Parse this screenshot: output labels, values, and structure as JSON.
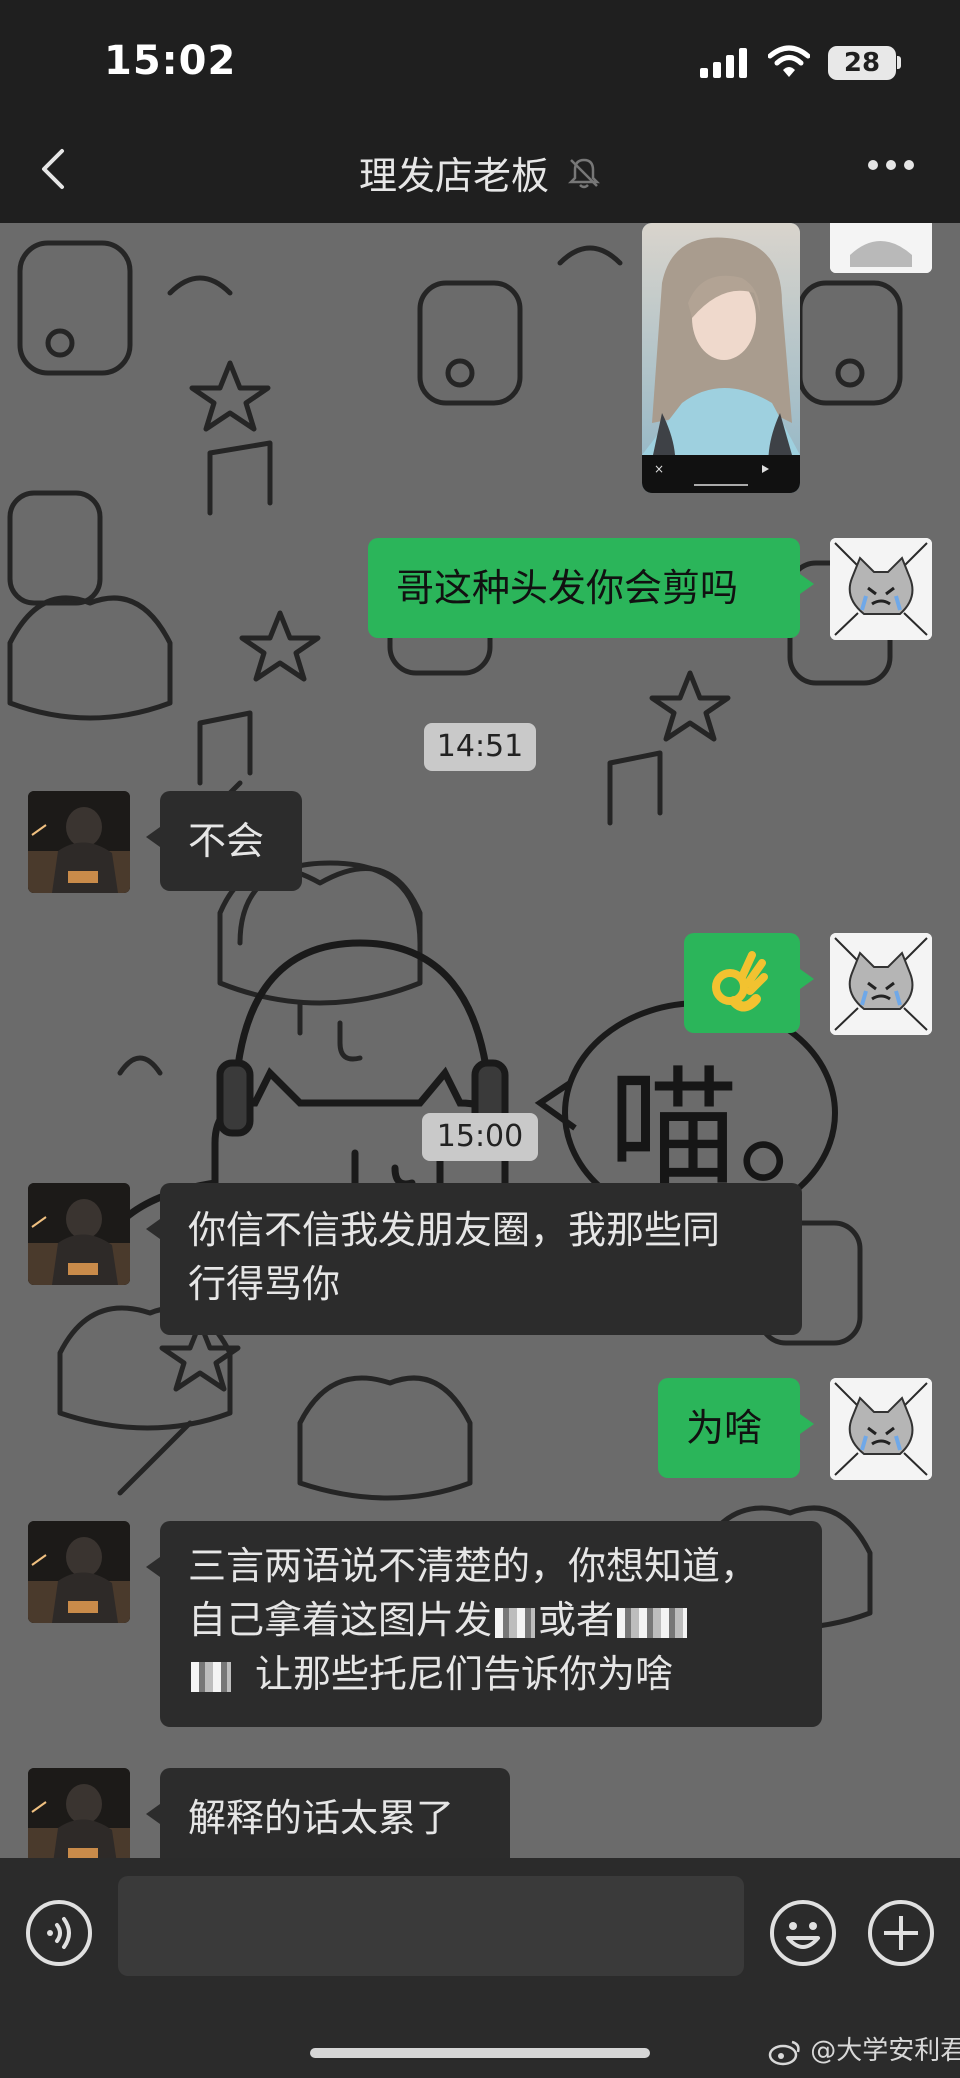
{
  "status_bar": {
    "time": "15:02",
    "battery": "28"
  },
  "header": {
    "title": "理发店老板",
    "back_icon": "chevron-left-icon",
    "mute_icon": "bell-muted-icon",
    "more_icon": "more-icon"
  },
  "messages": [
    {
      "type": "video",
      "side": "out"
    },
    {
      "type": "text",
      "side": "out",
      "text": "哥这种头发你会剪吗"
    },
    {
      "type": "time",
      "text": "14:51"
    },
    {
      "type": "text",
      "side": "in",
      "text": "不会"
    },
    {
      "type": "text",
      "side": "out",
      "text": "👌"
    },
    {
      "type": "time",
      "text": "15:00"
    },
    {
      "type": "text",
      "side": "in",
      "lines": [
        "你信不信我发朋友圈，我那些同",
        "行得骂你"
      ]
    },
    {
      "type": "text",
      "side": "out",
      "text": "为啥"
    },
    {
      "type": "text",
      "side": "in",
      "lines": [
        "三言两语说不清楚的，你想知道，",
        "自己拿着这图片发",
        "或者",
        "让那些托尼们告诉你为啥"
      ]
    },
    {
      "type": "text",
      "side": "in",
      "text": "解释的话太累了"
    }
  ],
  "wallpaper_text": "喵。",
  "input_bar": {
    "value": "",
    "voice_icon": "voice-icon",
    "emoji_icon": "emoji-icon",
    "plus_icon": "plus-icon"
  },
  "watermark": "@大学安利君",
  "colors": {
    "outgoing": "#2bb55a",
    "incoming": "#2c2c2c",
    "chat_bg": "#6b6b6b",
    "bar_bg": "#1f1f1f"
  }
}
